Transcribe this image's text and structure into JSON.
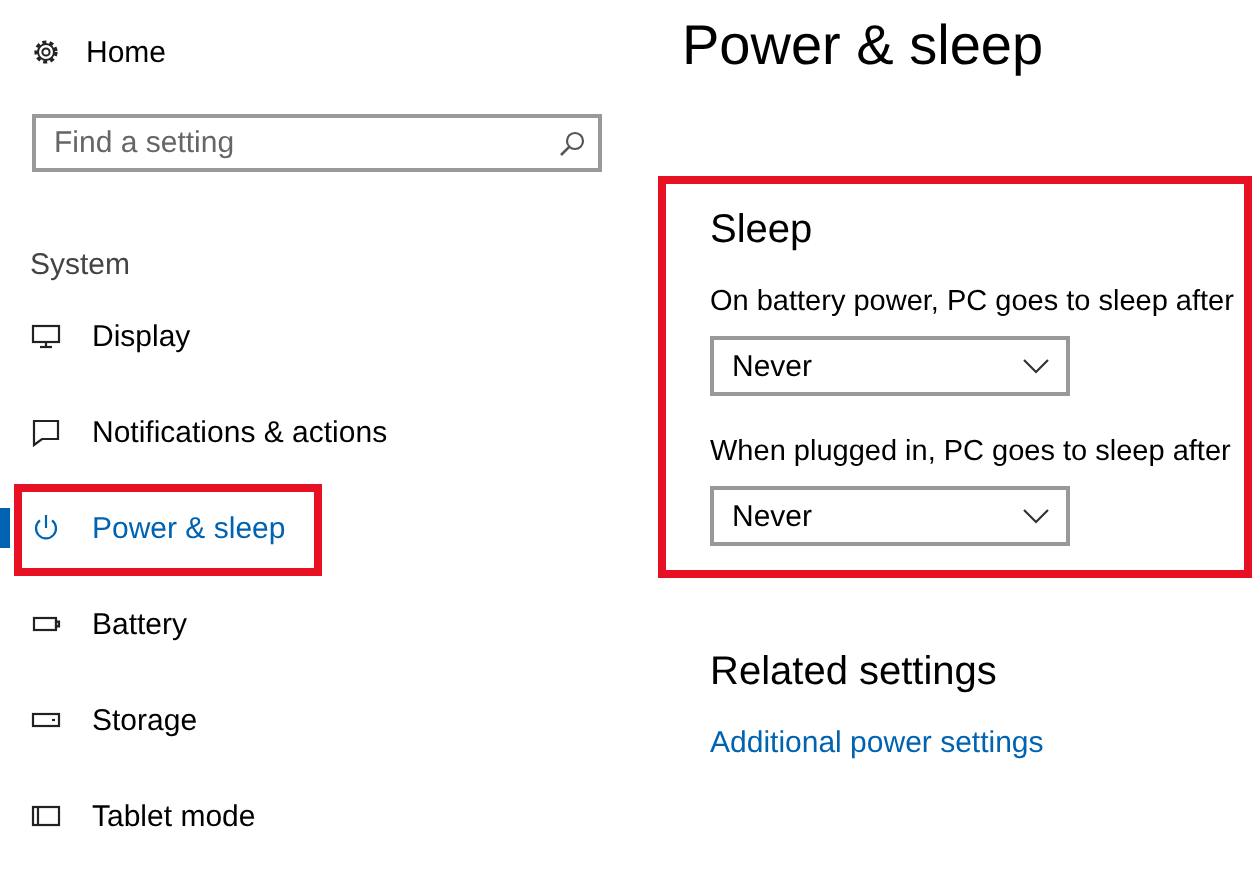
{
  "sidebar": {
    "home": "Home",
    "search": {
      "placeholder": "Find a setting"
    },
    "group": "System",
    "items": [
      {
        "label": "Display",
        "kind": "display",
        "selected": false,
        "highlighted": false
      },
      {
        "label": "Notifications & actions",
        "kind": "notifications",
        "selected": false,
        "highlighted": false
      },
      {
        "label": "Power & sleep",
        "kind": "power",
        "selected": true,
        "highlighted": true
      },
      {
        "label": "Battery",
        "kind": "battery",
        "selected": false,
        "highlighted": false
      },
      {
        "label": "Storage",
        "kind": "storage",
        "selected": false,
        "highlighted": false
      },
      {
        "label": "Tablet mode",
        "kind": "tablet",
        "selected": false,
        "highlighted": false
      }
    ]
  },
  "page": {
    "title": "Power & sleep",
    "sleep": {
      "heading": "Sleep",
      "highlighted": true,
      "settings": [
        {
          "label": "On battery power, PC goes to sleep after",
          "value": "Never"
        },
        {
          "label": "When plugged in, PC goes to sleep after",
          "value": "Never"
        }
      ]
    },
    "related": {
      "heading": "Related settings",
      "link": "Additional power settings"
    }
  }
}
